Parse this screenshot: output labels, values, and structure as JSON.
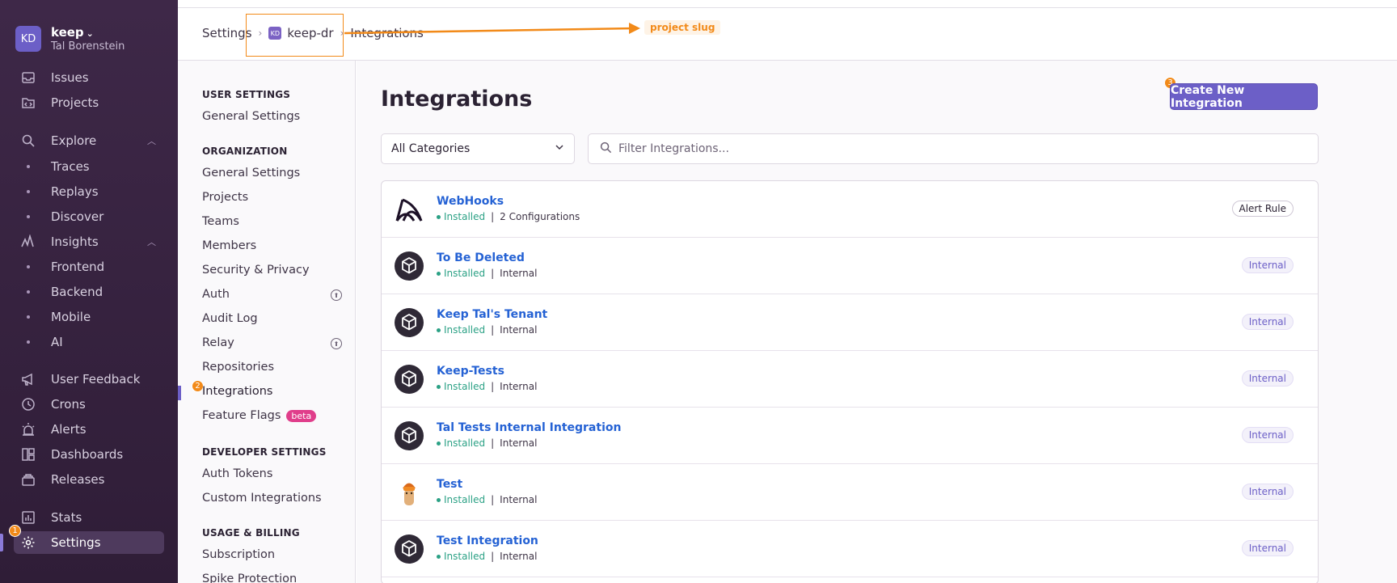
{
  "org": {
    "initials": "KD",
    "name": "keep",
    "user": "Tal Borenstein"
  },
  "sidebar": {
    "items": [
      {
        "label": "Issues",
        "icon": "inbox-icon"
      },
      {
        "label": "Projects",
        "icon": "code-folder-icon"
      },
      {
        "label": "Explore",
        "icon": "search-icon"
      },
      {
        "label": "Traces"
      },
      {
        "label": "Replays"
      },
      {
        "label": "Discover"
      },
      {
        "label": "Insights",
        "icon": "graph-icon"
      },
      {
        "label": "Frontend"
      },
      {
        "label": "Backend"
      },
      {
        "label": "Mobile"
      },
      {
        "label": "AI"
      },
      {
        "label": "User Feedback",
        "icon": "megaphone-icon"
      },
      {
        "label": "Crons",
        "icon": "history-icon"
      },
      {
        "label": "Alerts",
        "icon": "siren-icon"
      },
      {
        "label": "Dashboards",
        "icon": "dashboard-icon"
      },
      {
        "label": "Releases",
        "icon": "releases-icon"
      },
      {
        "label": "Stats",
        "icon": "stats-icon"
      },
      {
        "label": "Settings",
        "icon": "gear-icon"
      }
    ]
  },
  "breadcrumb": {
    "settings": "Settings",
    "project_initials": "KD",
    "project": "keep-dr",
    "current": "Integrations"
  },
  "annotations": {
    "slug_label": "project slug",
    "badge1": "1",
    "badge2": "2",
    "badge3": "3",
    "accent": "#f28a19"
  },
  "subnav": {
    "user_heading": "USER SETTINGS",
    "user_general": "General Settings",
    "org_heading": "ORGANIZATION",
    "org_items": [
      "General Settings",
      "Projects",
      "Teams",
      "Members",
      "Security & Privacy",
      "Auth",
      "Audit Log",
      "Relay",
      "Repositories",
      "Integrations",
      "Feature Flags"
    ],
    "beta": "beta",
    "dev_heading": "DEVELOPER SETTINGS",
    "dev_items": [
      "Auth Tokens",
      "Custom Integrations"
    ],
    "billing_heading": "USAGE & BILLING",
    "billing_items": [
      "Subscription",
      "Spike Protection"
    ]
  },
  "main": {
    "title": "Integrations",
    "create_label": "Create New Integration",
    "category": "All Categories",
    "search_placeholder": "Filter Integrations...",
    "rows": [
      {
        "name": "WebHooks",
        "status": "Installed",
        "detail": "2 Configurations",
        "tag": "Alert Rule",
        "logo": "webhooks-logo"
      },
      {
        "name": "To Be Deleted",
        "status": "Installed",
        "detail": "Internal",
        "tag": "Internal",
        "logo": "package-icon"
      },
      {
        "name": "Keep Tal's Tenant",
        "status": "Installed",
        "detail": "Internal",
        "tag": "Internal",
        "logo": "package-icon"
      },
      {
        "name": "Keep-Tests",
        "status": "Installed",
        "detail": "Internal",
        "tag": "Internal",
        "logo": "package-icon"
      },
      {
        "name": "Tal Tests Internal Integration",
        "status": "Installed",
        "detail": "Internal",
        "tag": "Internal",
        "logo": "package-icon"
      },
      {
        "name": "Test",
        "status": "Installed",
        "detail": "Internal",
        "tag": "Internal",
        "logo": "mascot-icon"
      },
      {
        "name": "Test Integration",
        "status": "Installed",
        "detail": "Internal",
        "tag": "Internal",
        "logo": "package-icon"
      }
    ]
  }
}
